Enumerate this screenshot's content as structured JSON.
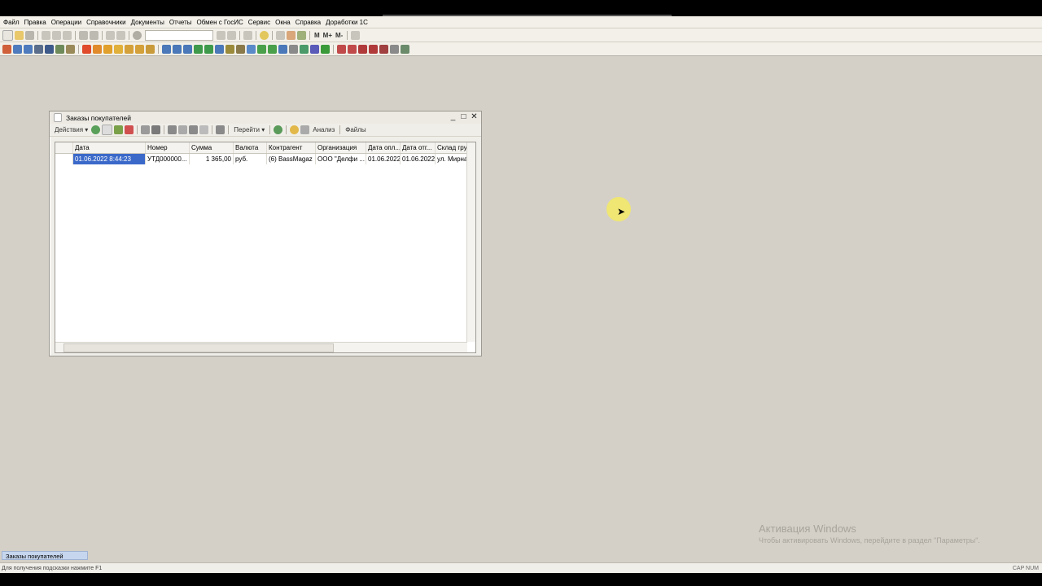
{
  "menu": [
    "Файл",
    "Правка",
    "Операции",
    "Справочники",
    "Документы",
    "Отчеты",
    "Обмен с ГосИС",
    "Сервис",
    "Окна",
    "Справка",
    "Доработки 1С"
  ],
  "toolbar_text": [
    "M",
    "M+",
    "M-"
  ],
  "window": {
    "title": "Заказы покупателей",
    "toolbar": {
      "actions": "Действия ▾",
      "goto": "Перейти ▾",
      "analysis": "Анализ",
      "files": "Файлы"
    },
    "columns": [
      "",
      "Дата",
      "Номер",
      "Сумма",
      "Валюта",
      "Контрагент",
      "Организация",
      "Дата опл...",
      "Дата отг...",
      "Склад груз..."
    ],
    "rows": [
      [
        "",
        "01.06.2022 8:44:23",
        "УТД000000...",
        "1 365,00",
        "руб.",
        "(6) BassMagaz",
        "ООО \"Делфи ...",
        "01.06.2022",
        "01.06.2022",
        "ул. Мирная..."
      ]
    ]
  },
  "activation": {
    "title": "Активация Windows",
    "subtitle": "Чтобы активировать Windows, перейдите в раздел \"Параметры\"."
  },
  "taskbar": {
    "item": "Заказы покупателей"
  },
  "status": {
    "hint": "Для получения подсказки нажмите F1",
    "right": "CAP  NUM"
  },
  "colors": {
    "selection": "#3b69c9",
    "background": "#d4d0c8"
  }
}
